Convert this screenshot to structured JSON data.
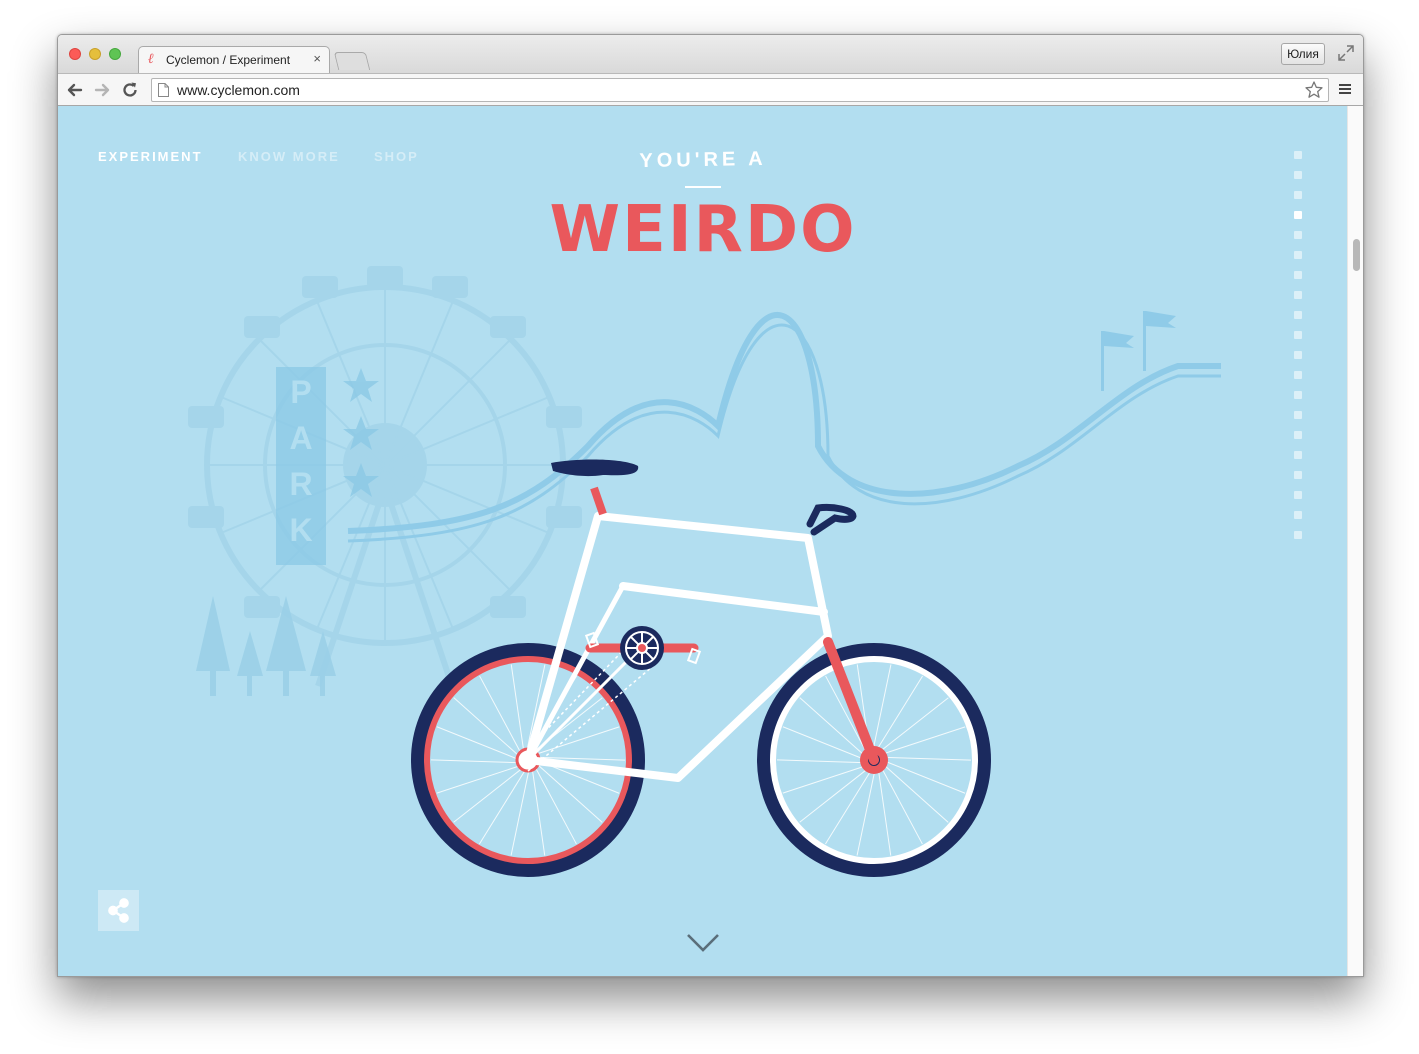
{
  "browser": {
    "tab": {
      "favicon": "ℓ",
      "title": "Cyclemon / Experiment",
      "close": "×"
    },
    "user_button": "Юлия",
    "address": "www.cyclemon.com",
    "icons": {
      "back": "back-arrow-icon",
      "forward": "forward-arrow-icon",
      "reload": "reload-icon",
      "page": "page-icon",
      "bookmark": "star-icon",
      "menu": "hamburger-menu-icon",
      "fullscreen": "fullscreen-icon"
    }
  },
  "site": {
    "nav": [
      {
        "label": "EXPERIMENT",
        "active": true
      },
      {
        "label": "KNOW MORE",
        "active": false
      },
      {
        "label": "SHOP",
        "active": false
      }
    ],
    "headline_small": "YOU'RE A",
    "headline_big": "WEIRDO",
    "sign_text": "PARK",
    "page_indicator": {
      "total": 20,
      "active_index": 3
    },
    "colors": {
      "background": "#b2def0",
      "accent": "#e9585c",
      "navy": "#1b2a5e",
      "bike_frame": "#ffffff"
    }
  }
}
